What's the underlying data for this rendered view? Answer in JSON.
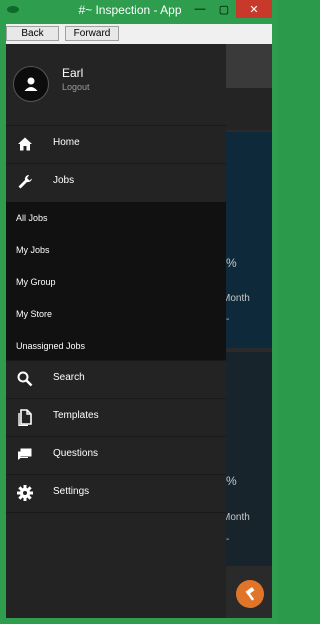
{
  "window": {
    "title": "#~ Inspection - App",
    "close_glyph": "✕",
    "maximize_glyph": "▢",
    "minimize_glyph": "—"
  },
  "nav": {
    "back_label": "Back",
    "forward_label": "Forward"
  },
  "profile": {
    "name": "Earl",
    "logout_label": "Logout"
  },
  "menu": {
    "home": "Home",
    "jobs": "Jobs",
    "jobs_sub": [
      "All Jobs",
      "My Jobs",
      "My Group",
      "My Store",
      "Unassigned Jobs"
    ],
    "search": "Search",
    "templates": "Templates",
    "questions": "Questions",
    "settings": "Settings"
  },
  "background": {
    "pct_1": "%",
    "month_1": "Month",
    "dash_1": "-",
    "pct_2": "%",
    "month_2": "Month",
    "dash_2": "-"
  },
  "colors": {
    "titlebar": "#2e9d4d",
    "drawer": "#232323",
    "submenu": "#111111",
    "fab": "#e0752a",
    "close": "#c7392b"
  }
}
